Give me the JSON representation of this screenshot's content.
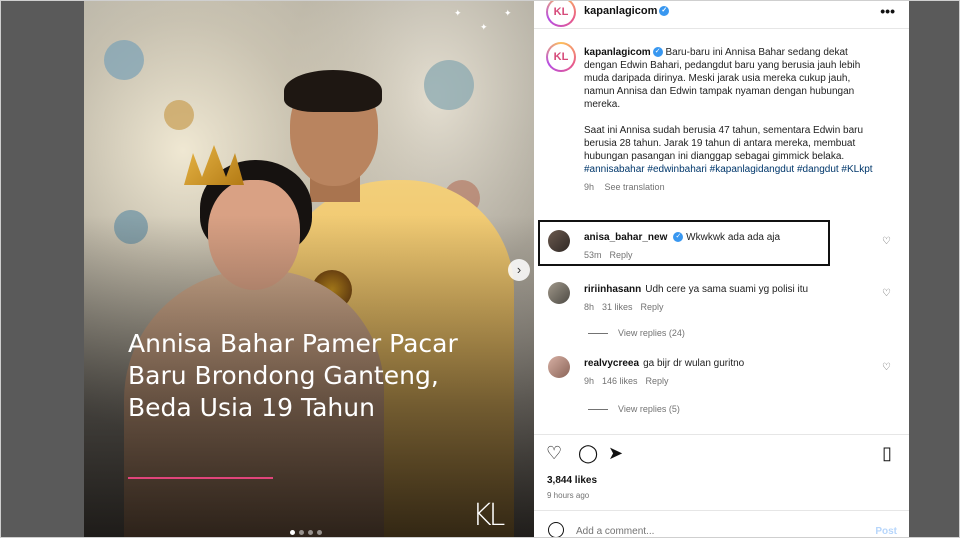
{
  "post": {
    "overlay": {
      "lines": [
        "Annisa Bahar Pamer Pacar",
        "Baru Brondong Ganteng,",
        "Beda Usia 19 Tahun"
      ],
      "logo": "KL"
    },
    "header": {
      "avatar_text": "KL",
      "username": "kapanlagicom"
    },
    "caption": {
      "handle": "kapanlagicom",
      "paragraph1": "Baru-baru ini Annisa Bahar sedang dekat dengan Edwin Bahari, pedangdut baru yang berusia jauh lebih muda daripada dirinya. Meski jarak usia mereka cukup jauh, namun Annisa dan Edwin tampak nyaman dengan hubungan mereka.",
      "paragraph2": "Saat ini Annisa sudah berusia 47 tahun, sementara Edwin baru berusia 28 tahun. Jarak 19 tahun di antara mereka, membuat hubungan pasangan ini dianggap sebagai gimmick belaka.",
      "tags": "#annisabahar #edwinbahari #kapanlagidangdut #dangdut #KLkpt",
      "time": "9h",
      "translate": "See translation"
    },
    "comments": [
      {
        "user": "anisa_bahar_new",
        "text": "Wkwkwk ada ada aja",
        "time": "53m",
        "likes": "",
        "reply": "Reply"
      },
      {
        "user": "ririinhasann",
        "text": "Udh cere ya sama suami yg polisi itu",
        "time": "8h",
        "likes": "31 likes",
        "reply": "Reply",
        "view_replies": "View replies (24)"
      },
      {
        "user": "realvycreea",
        "text": "ga bijr dr wulan guritno",
        "time": "9h",
        "likes": "146 likes",
        "reply": "Reply",
        "view_replies": "View replies (5)"
      }
    ],
    "likes": "3,844 likes",
    "time_ago": "9 hours ago",
    "add_comment_placeholder": "Add a comment...",
    "post_label": "Post"
  },
  "colors": {
    "accent_link": "#00376b",
    "verified": "#3897f0",
    "headline_rule": "#e0457b"
  }
}
